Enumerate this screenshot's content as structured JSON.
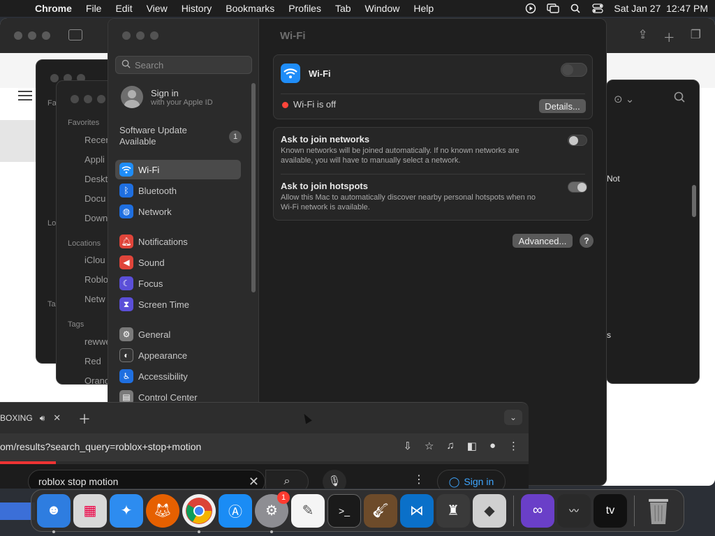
{
  "menubar": {
    "apple": "",
    "items": [
      "Chrome",
      "File",
      "Edit",
      "View",
      "History",
      "Bookmarks",
      "Profiles",
      "Tab",
      "Window",
      "Help"
    ],
    "datetime": "Sat Jan 27  12:47 PM"
  },
  "finder": {
    "sections": {
      "favorites": "Favorites",
      "locations": "Locations",
      "tags": "Tags"
    },
    "favorites": [
      "Recen",
      "Appli",
      "Deskt",
      "Docu",
      "Down"
    ],
    "locations": [
      "iClou",
      "Roblo",
      "Netw"
    ],
    "tags": [
      "rewwe",
      "Red",
      "Orang"
    ],
    "fa_short": "Fa",
    "lo_short": "Lo",
    "ta_short": "Ta"
  },
  "right_window": {
    "text1": "Not",
    "text2": "s"
  },
  "settings": {
    "search_placeholder": "Search",
    "signin": {
      "line1": "Sign in",
      "line2": "with your Apple ID"
    },
    "update": {
      "label": "Software Update Available",
      "badge": "1"
    },
    "sidebar_items": [
      {
        "label": "Wi-Fi",
        "color": "#1f8df8",
        "icon": "wifi-icon"
      },
      {
        "label": "Bluetooth",
        "color": "#1f6fe0",
        "icon": "bluetooth-icon"
      },
      {
        "label": "Network",
        "color": "#1f6fe0",
        "icon": "network-globe-icon"
      },
      {
        "label": "Notifications",
        "color": "#e0453a",
        "icon": "bell-icon"
      },
      {
        "label": "Sound",
        "color": "#e0453a",
        "icon": "speaker-icon"
      },
      {
        "label": "Focus",
        "color": "#5b4fd8",
        "icon": "moon-icon"
      },
      {
        "label": "Screen Time",
        "color": "#5b4fd8",
        "icon": "hourglass-icon"
      },
      {
        "label": "General",
        "color": "#7a7a7a",
        "icon": "gear-icon"
      },
      {
        "label": "Appearance",
        "color": "#333333",
        "icon": "appearance-icon"
      },
      {
        "label": "Accessibility",
        "color": "#1f6fe0",
        "icon": "accessibility-icon"
      },
      {
        "label": "Control Center",
        "color": "#7a7a7a",
        "icon": "control-center-icon"
      }
    ],
    "content_title": "Wi-Fi",
    "wifi_row_label": "Wi-Fi",
    "wifi_status": "Wi-Fi is off",
    "details_button": "Details...",
    "ask_networks_title": "Ask to join networks",
    "ask_networks_desc": "Known networks will be joined automatically. If no known networks are available, you will have to manually select a network.",
    "ask_hotspots_title": "Ask to join hotspots",
    "ask_hotspots_desc": "Allow this Mac to automatically discover nearby personal hotspots when no Wi-Fi network is available.",
    "advanced_button": "Advanced...",
    "help_button": "?"
  },
  "chrome": {
    "tab_title": "BOXING",
    "url": "om/results?search_query=roblox+stop+motion",
    "search_query": "roblox stop motion",
    "signin_label": "Sign in"
  },
  "dock": {
    "apps": [
      {
        "name": "finder-icon",
        "color": "#2e7de0"
      },
      {
        "name": "launchpad-icon",
        "color": "#e9e9e9"
      },
      {
        "name": "safari-icon",
        "color": "#2d8cf0"
      },
      {
        "name": "firefox-icon",
        "color": "#e66000"
      },
      {
        "name": "chrome-icon",
        "color": "#f0f0f0"
      },
      {
        "name": "app-store-icon",
        "color": "#1a8cf5"
      },
      {
        "name": "system-settings-icon",
        "color": "#8e8e93"
      },
      {
        "name": "textedit-icon",
        "color": "#f5f5f5"
      },
      {
        "name": "terminal-icon",
        "color": "#1a1a1a"
      },
      {
        "name": "garageband-icon",
        "color": "#6d4b2a"
      },
      {
        "name": "vscode-icon",
        "color": "#0a70c9"
      },
      {
        "name": "bartender-icon",
        "color": "#3a3a3a"
      },
      {
        "name": "roblox-icon",
        "color": "#d0d0d0"
      },
      {
        "name": "visual-studio-icon",
        "color": "#6a3fc8"
      },
      {
        "name": "activity-monitor-icon",
        "color": "#2a2a2a"
      },
      {
        "name": "apple-tv-icon",
        "color": "#111111"
      },
      {
        "name": "trash-icon",
        "color": "#8a8a8a"
      }
    ],
    "settings_badge": "1",
    "tv_label": "tv"
  }
}
